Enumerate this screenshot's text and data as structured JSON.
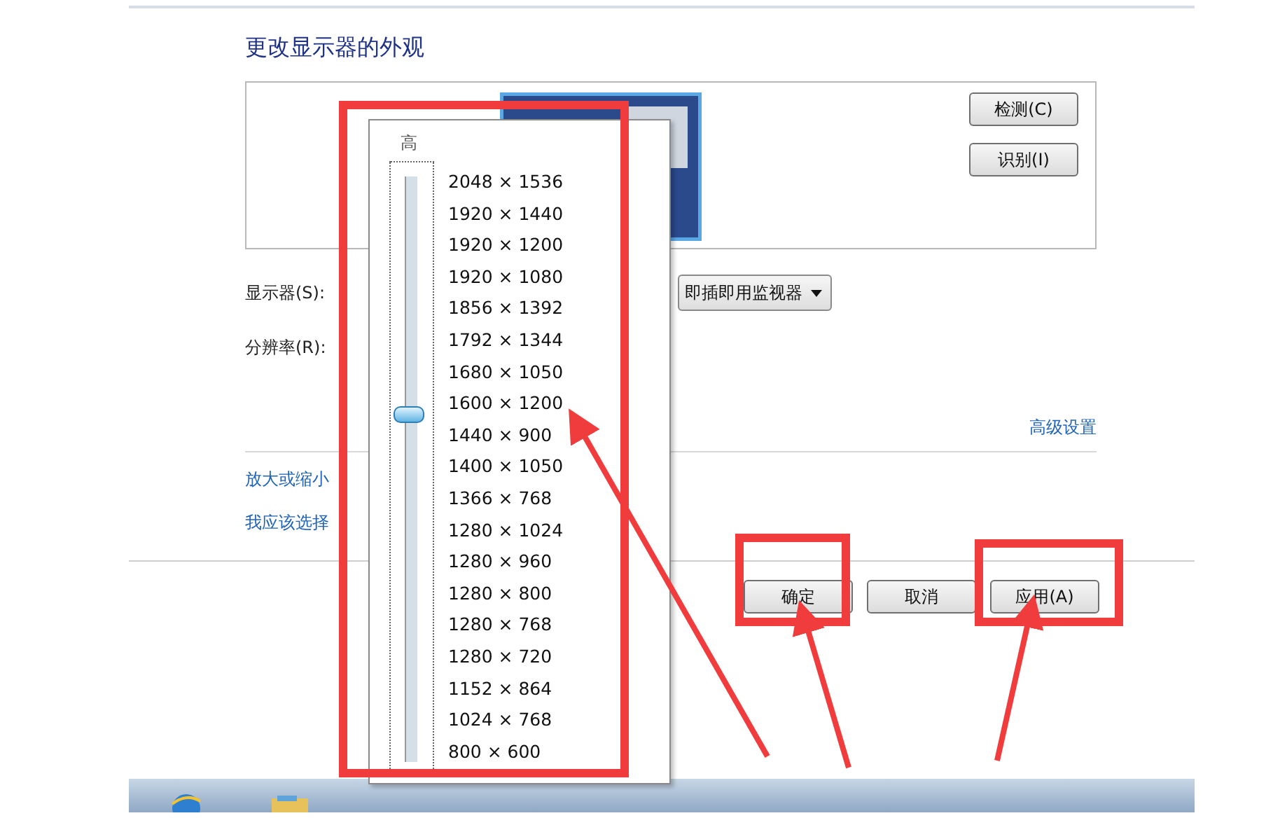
{
  "title": "更改显示器的外观",
  "side_buttons": [
    "检测(C)",
    "识别(I)"
  ],
  "display_label": "显示器(S):",
  "display_select": {
    "value": "即插即用监视器"
  },
  "resolution_label": "分辨率(R):",
  "advanced_link": "高级设置",
  "links": [
    "放大或缩小",
    "我应该选择"
  ],
  "buttons": [
    "确定",
    "取消",
    "应用(A)"
  ],
  "resolution_popup": {
    "top_label": "高",
    "slider": {
      "level": 0.588
    },
    "options": [
      "2048 × 1536",
      "1920 × 1440",
      "1920 × 1200",
      "1920 × 1080",
      "1856 × 1392",
      "1792 × 1344",
      "1680 × 1050",
      "1600 × 1200",
      "1440 × 900",
      "1400 × 1050",
      "1366 × 768",
      "1280 × 1024",
      "1280 × 960",
      "1280 × 800",
      "1280 × 768",
      "1280 × 720",
      "1152 × 864",
      "1024 × 768",
      "800 × 600"
    ]
  }
}
